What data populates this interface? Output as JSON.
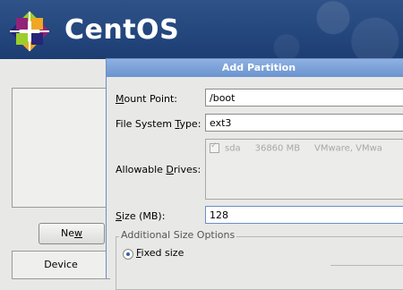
{
  "banner": {
    "brand": "CentOS"
  },
  "background": {
    "new_button": "New",
    "new_button_mnemonic": "w",
    "device_label": "Device"
  },
  "dialog": {
    "title": "Add Partition",
    "mount_point_label": "Mount Point:",
    "mount_point_value": "/boot",
    "fs_type_label": "File System Type:",
    "fs_type_value": "ext3",
    "allowable_drives_label": "Allowable Drives:",
    "drives": [
      {
        "checked": true,
        "name": "sda",
        "size": "36860 MB",
        "model": "VMware, VMwa"
      }
    ],
    "size_label": "Size (MB):",
    "size_value": "128",
    "additional_options_title": "Additional Size Options",
    "fixed_size_label": "Fixed size"
  },
  "colors": {
    "banner": "#23467d",
    "titlebar": "#6a93cf",
    "dialog_bg": "#e8e8e6"
  }
}
